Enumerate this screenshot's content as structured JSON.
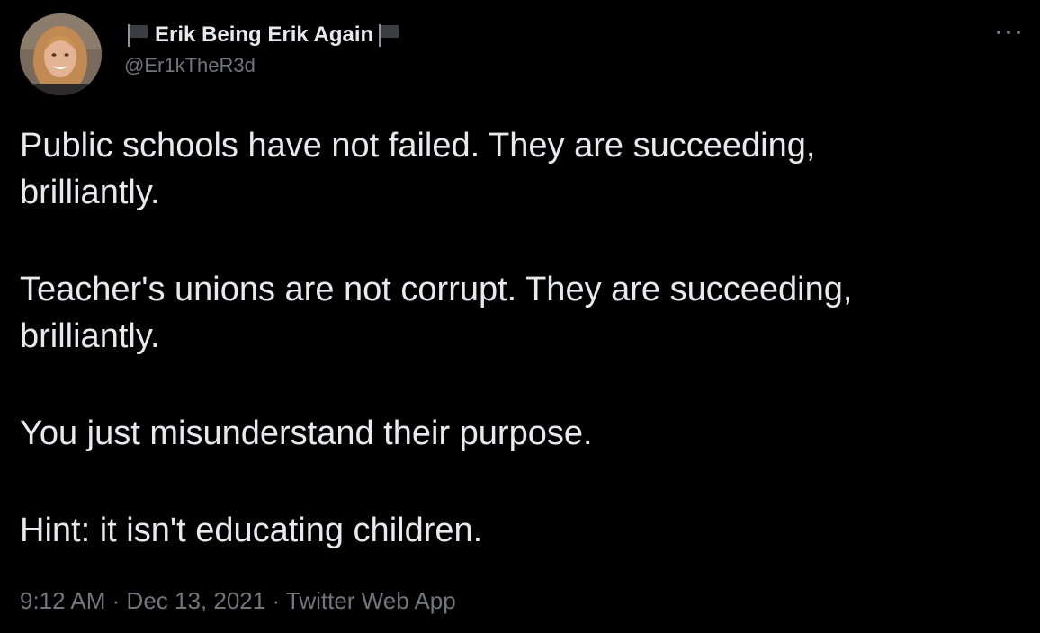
{
  "user": {
    "display_name": "Erik Being Erik Again",
    "handle": "@Er1kTheR3d",
    "flag_icon": "black-flag-icon"
  },
  "tweet": {
    "paragraphs": [
      [
        "Public schools have not failed. They are succeeding,",
        "brilliantly."
      ],
      [
        "Teacher's unions are not corrupt. They are succeeding,",
        "brilliantly."
      ],
      [
        "You just misunderstand their purpose."
      ],
      [
        "Hint: it isn't educating children."
      ]
    ]
  },
  "meta": {
    "time": "9:12 AM",
    "separator": "·",
    "date": "Dec 13, 2021",
    "source": "Twitter Web App"
  },
  "colors": {
    "background": "#000000",
    "text": "#e7e9ea",
    "secondary": "#71767b"
  }
}
